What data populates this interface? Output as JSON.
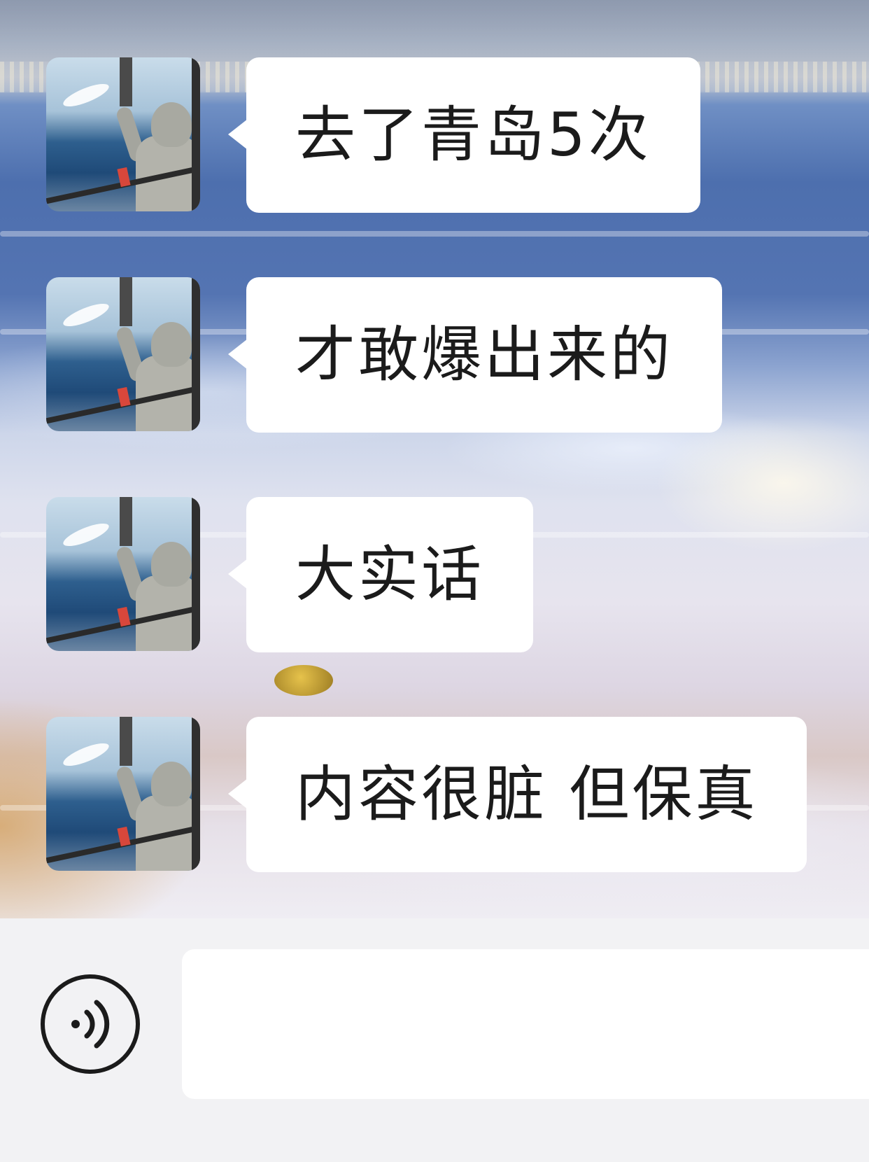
{
  "chat": {
    "messages": [
      {
        "text": "去了青岛5次"
      },
      {
        "text": "才敢爆出来的"
      },
      {
        "text": "大实话"
      },
      {
        "text": "内容很脏 但保真"
      }
    ],
    "avatar_icon": "profile-photo-person-with-seagulls-on-boat"
  },
  "input_bar": {
    "voice_icon": "voice-input-icon",
    "text_value": "",
    "placeholder": ""
  },
  "colors": {
    "bubble": "#ffffff",
    "text": "#1b1b1b",
    "input_bar_bg": "#f2f2f4"
  }
}
